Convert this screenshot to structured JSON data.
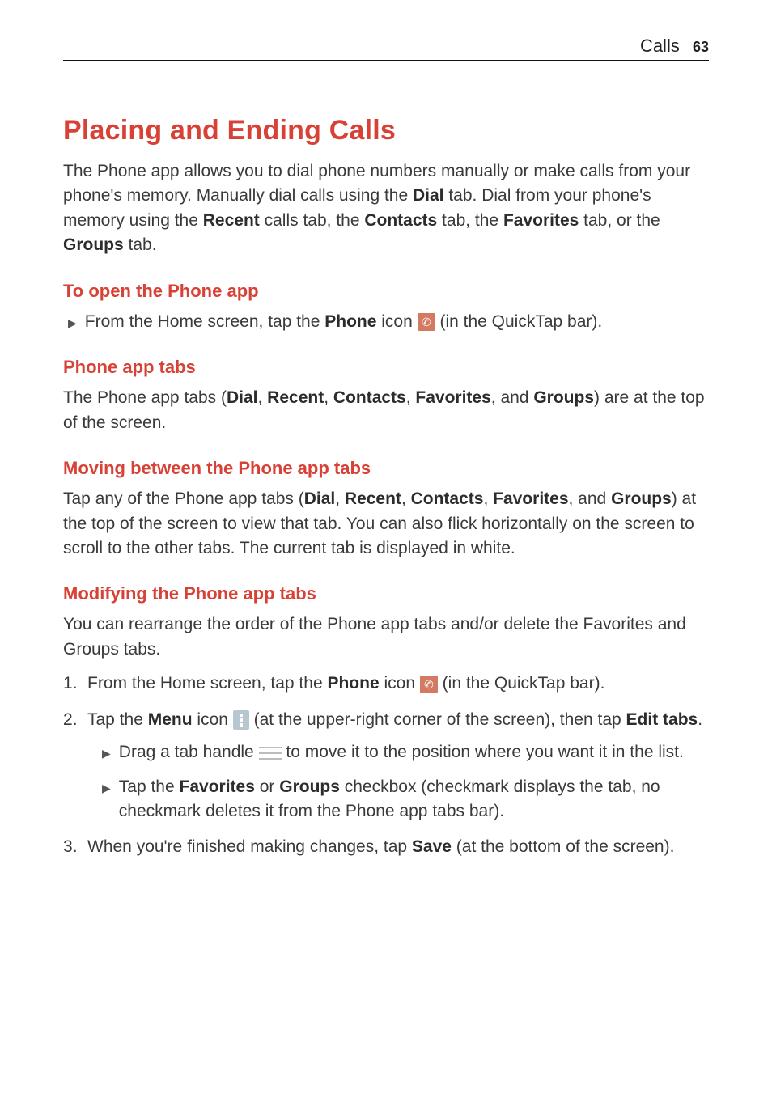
{
  "header": {
    "section": "Calls",
    "page_number": "63"
  },
  "title": "Placing and Ending Calls",
  "intro": {
    "p1a": "The Phone app allows you to dial phone numbers manually or make calls from your phone's memory. Manually dial calls using the ",
    "b1": "Dial",
    "p1b": " tab. Dial from your phone's memory using the ",
    "b2": "Recent",
    "p1c": " calls tab, the ",
    "b3": "Contacts",
    "p1d": " tab, the ",
    "b4": "Favorites",
    "p1e": " tab, or the ",
    "b5": "Groups",
    "p1f": " tab."
  },
  "sec_open": {
    "heading": "To open the Phone app",
    "line_a": "From the Home screen, tap the ",
    "bold_phone": "Phone",
    "line_b": " icon ",
    "line_c": " (in the QuickTap bar)."
  },
  "sec_tabs": {
    "heading": "Phone app tabs",
    "p_a": "The Phone app tabs (",
    "b1": "Dial",
    "c1": ", ",
    "b2": "Recent",
    "c2": ", ",
    "b3": "Contacts",
    "c3": ", ",
    "b4": "Favorites",
    "c4": ", and ",
    "b5": "Groups",
    "p_b": ") are at the top of the screen."
  },
  "sec_move": {
    "heading": "Moving between the Phone app tabs",
    "p_a": "Tap any of the Phone app tabs (",
    "b1": "Dial",
    "c1": ", ",
    "b2": "Recent",
    "c2": ", ",
    "b3": "Contacts",
    "c3": ", ",
    "b4": "Favorites",
    "c4": ", and ",
    "b5": "Groups",
    "p_b": ") at the top of the screen to view that tab. You can also flick horizontally on the screen to scroll to the other tabs. The current tab is displayed in white."
  },
  "sec_modify": {
    "heading": "Modifying the Phone app tabs",
    "intro": "You can rearrange the order of the Phone app tabs and/or delete the Favorites and Groups tabs.",
    "step1": {
      "a": "From the Home screen, tap the ",
      "b_phone": "Phone",
      "b": " icon ",
      "c": " (in the QuickTap bar)."
    },
    "step2": {
      "a": "Tap the ",
      "b_menu": "Menu",
      "b": " icon ",
      "c": " (at the upper-right corner of the screen), then tap ",
      "b_edit": "Edit tabs",
      "d": "."
    },
    "step2_sub1": {
      "a": "Drag a tab handle ",
      "b": " to move it to the position where you want it in the list."
    },
    "step2_sub2": {
      "a": "Tap the ",
      "b_fav": "Favorites",
      "b": " or ",
      "b_grp": "Groups",
      "c": " checkbox (checkmark displays the tab, no checkmark deletes it from the Phone app tabs bar)."
    },
    "step3": {
      "a": "When you're finished making changes, tap ",
      "b_save": "Save",
      "b": " (at the bottom of the screen)."
    }
  }
}
